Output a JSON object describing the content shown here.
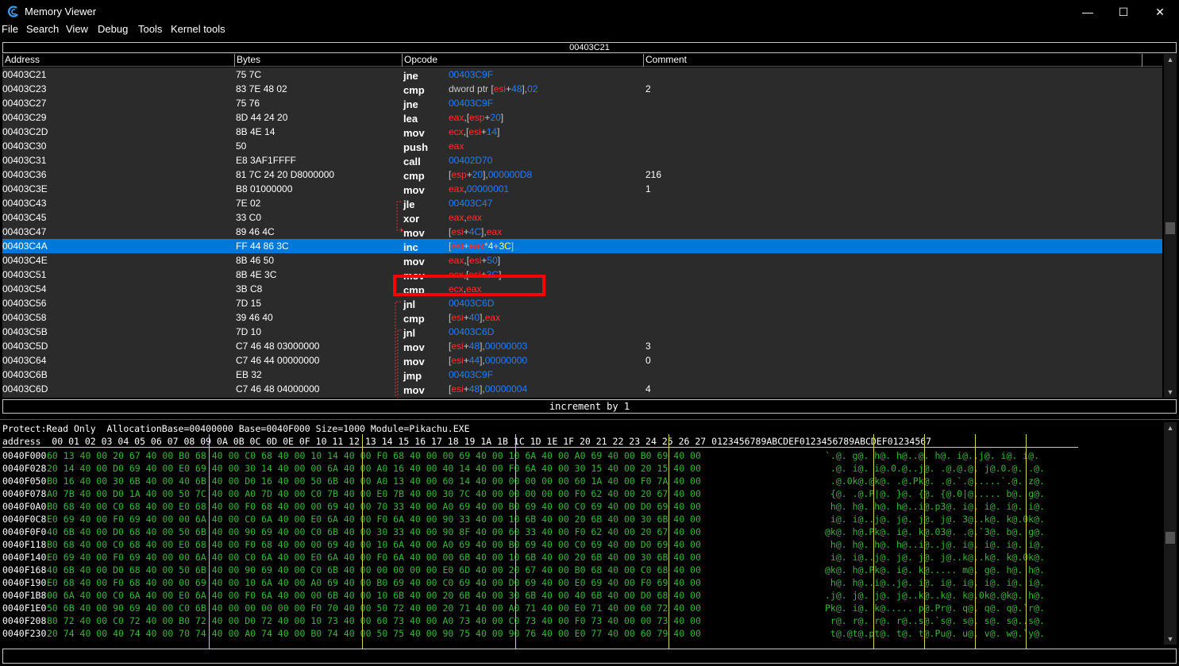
{
  "window": {
    "title": "Memory Viewer",
    "minimize": "—",
    "maximize": "☐",
    "close": "✕"
  },
  "menu": [
    "File",
    "Search",
    "View",
    "Debug",
    "Tools",
    "Kernel tools"
  ],
  "disassembler": {
    "current_address": "00403C21",
    "columns": [
      "Address",
      "Bytes",
      "Opcode",
      "Comment"
    ],
    "rows": [
      {
        "address": "00403C21",
        "bytes": "75 7C",
        "mnemonic": "jne",
        "operands": [
          {
            "t": "00403C9F",
            "c": "num"
          }
        ],
        "comment": ""
      },
      {
        "address": "00403C23",
        "bytes": "83 7E 48 02",
        "mnemonic": "cmp",
        "operands": [
          {
            "t": "dword ptr [",
            "c": "txt"
          },
          {
            "t": "esi",
            "c": "reg"
          },
          {
            "t": "+",
            "c": "txt"
          },
          {
            "t": "48",
            "c": "num"
          },
          {
            "t": "],",
            "c": "txt"
          },
          {
            "t": "02",
            "c": "num"
          }
        ],
        "comment": "2"
      },
      {
        "address": "00403C27",
        "bytes": "75 76",
        "mnemonic": "jne",
        "operands": [
          {
            "t": "00403C9F",
            "c": "num"
          }
        ],
        "comment": ""
      },
      {
        "address": "00403C29",
        "bytes": "8D 44 24 20",
        "mnemonic": "lea",
        "operands": [
          {
            "t": "eax",
            "c": "reg"
          },
          {
            "t": ",[",
            "c": "txt"
          },
          {
            "t": "esp",
            "c": "reg"
          },
          {
            "t": "+",
            "c": "txt"
          },
          {
            "t": "20",
            "c": "num"
          },
          {
            "t": "]",
            "c": "txt"
          }
        ],
        "comment": ""
      },
      {
        "address": "00403C2D",
        "bytes": "8B 4E 14",
        "mnemonic": "mov",
        "operands": [
          {
            "t": "ecx",
            "c": "reg"
          },
          {
            "t": ",[",
            "c": "txt"
          },
          {
            "t": "esi",
            "c": "reg"
          },
          {
            "t": "+",
            "c": "txt"
          },
          {
            "t": "14",
            "c": "num"
          },
          {
            "t": "]",
            "c": "txt"
          }
        ],
        "comment": ""
      },
      {
        "address": "00403C30",
        "bytes": "50",
        "mnemonic": "push",
        "operands": [
          {
            "t": "eax",
            "c": "reg"
          }
        ],
        "comment": ""
      },
      {
        "address": "00403C31",
        "bytes": "E8 3AF1FFFF",
        "mnemonic": "call",
        "operands": [
          {
            "t": "00402D70",
            "c": "num"
          }
        ],
        "comment": ""
      },
      {
        "address": "00403C36",
        "bytes": "81 7C 24 20 D8000000",
        "mnemonic": "cmp",
        "operands": [
          {
            "t": "[",
            "c": "txt"
          },
          {
            "t": "esp",
            "c": "reg"
          },
          {
            "t": "+",
            "c": "txt"
          },
          {
            "t": "20",
            "c": "num"
          },
          {
            "t": "],",
            "c": "txt"
          },
          {
            "t": "000000D8",
            "c": "num"
          }
        ],
        "comment": "216"
      },
      {
        "address": "00403C3E",
        "bytes": "B8 01000000",
        "mnemonic": "mov",
        "operands": [
          {
            "t": "eax",
            "c": "reg"
          },
          {
            "t": ",",
            "c": "txt"
          },
          {
            "t": "00000001",
            "c": "num"
          }
        ],
        "comment": "1"
      },
      {
        "address": "00403C43",
        "bytes": "7E 02",
        "mnemonic": "jle",
        "operands": [
          {
            "t": "00403C47",
            "c": "num"
          }
        ],
        "comment": ""
      },
      {
        "address": "00403C45",
        "bytes": "33 C0",
        "mnemonic": "xor",
        "operands": [
          {
            "t": "eax",
            "c": "reg"
          },
          {
            "t": ",",
            "c": "txt"
          },
          {
            "t": "eax",
            "c": "reg"
          }
        ],
        "comment": ""
      },
      {
        "address": "00403C47",
        "bytes": "89 46 4C",
        "mnemonic": "mov",
        "operands": [
          {
            "t": "[",
            "c": "txt"
          },
          {
            "t": "esi",
            "c": "reg"
          },
          {
            "t": "+",
            "c": "txt"
          },
          {
            "t": "4C",
            "c": "num"
          },
          {
            "t": "],",
            "c": "txt"
          },
          {
            "t": "eax",
            "c": "reg"
          }
        ],
        "comment": ""
      },
      {
        "address": "00403C4A",
        "bytes": "FF 44 86 3C",
        "mnemonic": "inc",
        "operands": [
          {
            "t": "[",
            "c": "txt"
          },
          {
            "t": "esi",
            "c": "reg"
          },
          {
            "t": "+",
            "c": "txt"
          },
          {
            "t": "eax",
            "c": "reg"
          },
          {
            "t": "*",
            "c": "txt"
          },
          {
            "t": "4",
            "c": "num"
          },
          {
            "t": "+",
            "c": "txt"
          },
          {
            "t": "3C",
            "c": "num"
          },
          {
            "t": "]",
            "c": "txt"
          }
        ],
        "comment": "",
        "selected": true
      },
      {
        "address": "00403C4E",
        "bytes": "8B 46 50",
        "mnemonic": "mov",
        "operands": [
          {
            "t": "eax",
            "c": "reg"
          },
          {
            "t": ",[",
            "c": "txt"
          },
          {
            "t": "esi",
            "c": "reg"
          },
          {
            "t": "+",
            "c": "txt"
          },
          {
            "t": "50",
            "c": "num"
          },
          {
            "t": "]",
            "c": "txt"
          }
        ],
        "comment": ""
      },
      {
        "address": "00403C51",
        "bytes": "8B 4E 3C",
        "mnemonic": "mov",
        "operands": [
          {
            "t": "ecx",
            "c": "reg"
          },
          {
            "t": ",[",
            "c": "txt"
          },
          {
            "t": "esi",
            "c": "reg"
          },
          {
            "t": "+",
            "c": "txt"
          },
          {
            "t": "3C",
            "c": "num"
          },
          {
            "t": "]",
            "c": "txt"
          }
        ],
        "comment": ""
      },
      {
        "address": "00403C54",
        "bytes": "3B C8",
        "mnemonic": "cmp",
        "operands": [
          {
            "t": "ecx",
            "c": "reg"
          },
          {
            "t": ",",
            "c": "txt"
          },
          {
            "t": "eax",
            "c": "reg"
          }
        ],
        "comment": ""
      },
      {
        "address": "00403C56",
        "bytes": "7D 15",
        "mnemonic": "jnl",
        "operands": [
          {
            "t": "00403C6D",
            "c": "num"
          }
        ],
        "comment": ""
      },
      {
        "address": "00403C58",
        "bytes": "39 46 40",
        "mnemonic": "cmp",
        "operands": [
          {
            "t": "[",
            "c": "txt"
          },
          {
            "t": "esi",
            "c": "reg"
          },
          {
            "t": "+",
            "c": "txt"
          },
          {
            "t": "40",
            "c": "num"
          },
          {
            "t": "],",
            "c": "txt"
          },
          {
            "t": "eax",
            "c": "reg"
          }
        ],
        "comment": ""
      },
      {
        "address": "00403C5B",
        "bytes": "7D 10",
        "mnemonic": "jnl",
        "operands": [
          {
            "t": "00403C6D",
            "c": "num"
          }
        ],
        "comment": ""
      },
      {
        "address": "00403C5D",
        "bytes": "C7 46 48 03000000",
        "mnemonic": "mov",
        "operands": [
          {
            "t": "[",
            "c": "txt"
          },
          {
            "t": "esi",
            "c": "reg"
          },
          {
            "t": "+",
            "c": "txt"
          },
          {
            "t": "48",
            "c": "num"
          },
          {
            "t": "],",
            "c": "txt"
          },
          {
            "t": "00000003",
            "c": "num"
          }
        ],
        "comment": "3"
      },
      {
        "address": "00403C64",
        "bytes": "C7 46 44 00000000",
        "mnemonic": "mov",
        "operands": [
          {
            "t": "[",
            "c": "txt"
          },
          {
            "t": "esi",
            "c": "reg"
          },
          {
            "t": "+",
            "c": "txt"
          },
          {
            "t": "44",
            "c": "num"
          },
          {
            "t": "],",
            "c": "txt"
          },
          {
            "t": "00000000",
            "c": "num"
          }
        ],
        "comment": "0"
      },
      {
        "address": "00403C6B",
        "bytes": "EB 32",
        "mnemonic": "jmp",
        "operands": [
          {
            "t": "00403C9F",
            "c": "num"
          }
        ],
        "comment": ""
      },
      {
        "address": "00403C6D",
        "bytes": "C7 46 48 04000000",
        "mnemonic": "mov",
        "operands": [
          {
            "t": "[",
            "c": "txt"
          },
          {
            "t": "esi",
            "c": "reg"
          },
          {
            "t": "+",
            "c": "txt"
          },
          {
            "t": "48",
            "c": "num"
          },
          {
            "t": "],",
            "c": "txt"
          },
          {
            "t": "00000004",
            "c": "num"
          }
        ],
        "comment": "4"
      }
    ],
    "info": "increment by 1"
  },
  "hex_view": {
    "protect_line": "Protect:Read Only  AllocationBase=00400000 Base=0040F000 Size=1000 Module=Pikachu.EXE",
    "header": "address  00 01 02 03 04 05 06 07 08 09 0A 0B 0C 0D 0E 0F 10 11 12 13 14 15 16 17 18 19 1A 1B 1C 1D 1E 1F 20 21 22 23 24 25 26 27 0123456789ABCDEF0123456789ABCDEF01234567",
    "rows": [
      {
        "address": "0040F000",
        "bytes": "60 13 40 00 20 67 40 00 B0 68 40 00 C0 68 40 00 10 14 40 00 F0 68 40 00 00 69 40 00 10 6A 40 00 A0 69 40 00 B0 69 40 00",
        "ascii": "`.@. g@. h@. h@..@. h@. i@..j@. i@. i@."
      },
      {
        "address": "0040F028",
        "bytes": "20 14 40 00 D0 69 40 00 E0 69 40 00 30 14 40 00 00 6A 40 00 A0 16 40 00 40 14 40 00 F0 6A 40 00 30 15 40 00 20 15 40 00",
        "ascii": " .@. i@. i@.0.@..j@. .@.@.@. j@.0.@. .@."
      },
      {
        "address": "0040F050",
        "bytes": "B0 16 40 00 30 6B 40 00 40 6B 40 00 D0 16 40 00 50 6B 40 00 A0 13 40 00 60 14 40 00 00 00 00 00 60 1A 40 00 F0 7A 40 00",
        "ascii": " .@.0k@.@k@. .@.Pk@. .@.`.@.....`.@. z@."
      },
      {
        "address": "0040F078",
        "bytes": "A0 7B 40 00 D0 1A 40 00 50 7C 40 00 A0 7D 40 00 C0 7B 40 00 E0 7B 40 00 30 7C 40 00 00 00 00 00 F0 62 40 00 20 67 40 00",
        "ascii": " {@. .@.P|@. }@. {@. {@.0|@..... b@. g@."
      },
      {
        "address": "0040F0A0",
        "bytes": "B0 68 40 00 C0 68 40 00 E0 68 40 00 F0 68 40 00 00 69 40 00 70 33 40 00 A0 69 40 00 B0 69 40 00 C0 69 40 00 D0 69 40 00",
        "ascii": " h@. h@. h@. h@..i@.p3@. i@. i@. i@. i@."
      },
      {
        "address": "0040F0C8",
        "bytes": "E0 69 40 00 F0 69 40 00 00 6A 40 00 C0 6A 40 00 E0 6A 40 00 F0 6A 40 00 90 33 40 00 10 6B 40 00 20 6B 40 00 30 6B 40 00",
        "ascii": " i@. i@..j@. j@. j@. j@. 3@..k@. k@.0k@."
      },
      {
        "address": "0040F0F0",
        "bytes": "40 6B 40 00 D0 68 40 00 50 6B 40 00 90 69 40 00 C0 6B 40 00 30 33 40 00 90 8F 40 00 60 33 40 00 F0 62 40 00 20 67 40 00",
        "ascii": "@k@. h@.Pk@. i@. k@.03@. .@.`3@. b@. g@."
      },
      {
        "address": "0040F118",
        "bytes": "B0 68 40 00 C0 68 40 00 E0 68 40 00 F0 68 40 00 00 69 40 00 10 6A 40 00 A0 69 40 00 B0 69 40 00 C0 69 40 00 D0 69 40 00",
        "ascii": " h@. h@. h@. h@..i@..j@. i@. i@. i@. i@."
      },
      {
        "address": "0040F140",
        "bytes": "E0 69 40 00 F0 69 40 00 00 6A 40 00 C0 6A 40 00 E0 6A 40 00 F0 6A 40 00 00 6B 40 00 10 6B 40 00 20 6B 40 00 30 6B 40 00",
        "ascii": " i@. i@..j@. j@. j@. j@..k@..k@. k@.0k@."
      },
      {
        "address": "0040F168",
        "bytes": "40 6B 40 00 D0 68 40 00 50 6B 40 00 90 69 40 00 C0 6B 40 00 00 00 00 00 E0 6D 40 00 20 67 40 00 B0 68 40 00 C0 68 40 00",
        "ascii": "@k@. h@.Pk@. i@. k@..... m@. g@. h@. h@."
      },
      {
        "address": "0040F190",
        "bytes": "E0 68 40 00 F0 68 40 00 00 69 40 00 10 6A 40 00 A0 69 40 00 B0 69 40 00 C0 69 40 00 D0 69 40 00 E0 69 40 00 F0 69 40 00",
        "ascii": " h@. h@..i@..j@. i@. i@. i@. i@. i@. i@."
      },
      {
        "address": "0040F1B8",
        "bytes": "00 6A 40 00 C0 6A 40 00 E0 6A 40 00 F0 6A 40 00 00 6B 40 00 10 6B 40 00 20 6B 40 00 30 6B 40 00 40 6B 40 00 D0 68 40 00",
        "ascii": ".j@. j@. j@. j@..k@..k@. k@.0k@.@k@. h@."
      },
      {
        "address": "0040F1E0",
        "bytes": "50 6B 40 00 90 69 40 00 C0 6B 40 00 00 00 00 00 F0 70 40 00 50 72 40 00 20 71 40 00 A0 71 40 00 E0 71 40 00 60 72 40 00",
        "ascii": "Pk@. i@. k@..... p@.Pr@. q@. q@. q@.`r@."
      },
      {
        "address": "0040F208",
        "bytes": "80 72 40 00 C0 72 40 00 B0 72 40 00 D0 72 40 00 10 73 40 00 60 73 40 00 A0 73 40 00 C0 73 40 00 F0 73 40 00 00 73 40 00",
        "ascii": " r@. r@. r@. r@..s@.`s@. s@. s@. s@..s@."
      },
      {
        "address": "0040F230",
        "bytes": "20 74 40 00 40 74 40 00 70 74 40 00 A0 74 40 00 B0 74 40 00 50 75 40 00 90 75 40 00 90 76 40 00 E0 77 40 00 60 79 40 00",
        "ascii": " t@.@t@.pt@. t@. t@.Pu@. u@. v@. w@.`y@."
      }
    ]
  },
  "icons": {
    "app": "cheat-engine-icon",
    "scroll_up": "scroll-up-arrow-icon",
    "scroll_down": "scroll-down-arrow-icon"
  },
  "colors": {
    "selection": "#0078d7",
    "register": "#ff3030",
    "number": "#1e7fff",
    "hex_bytes": "#34b834",
    "highlight_box": "#ff0000",
    "separator": "#d8d850"
  }
}
